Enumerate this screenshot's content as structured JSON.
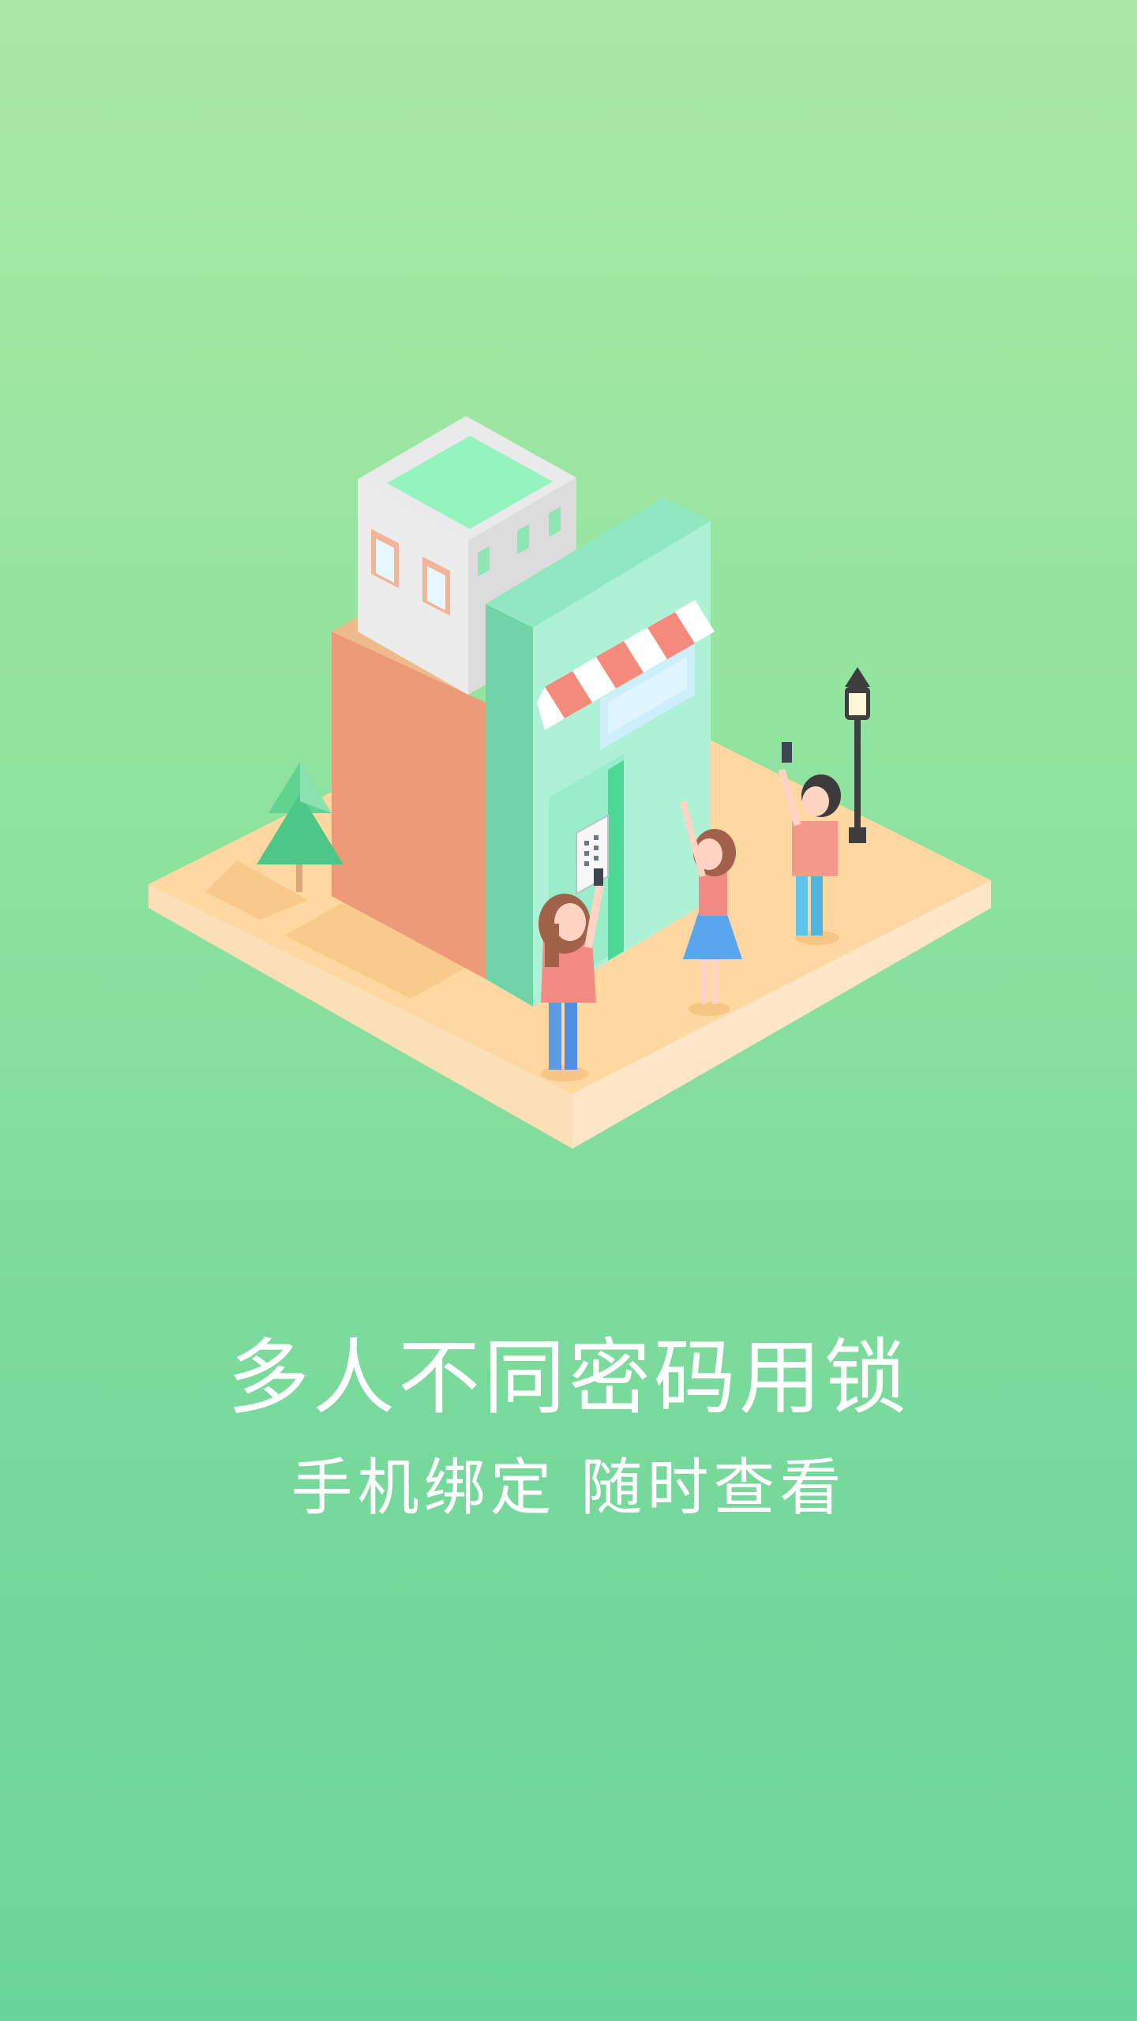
{
  "onboarding": {
    "headline": "多人不同密码用锁",
    "subline": "手机绑定  随时查看",
    "illustration": "isometric-building-with-people-using-smart-lock",
    "colors": {
      "background_top": "#aae8a6",
      "background_bottom": "#6ad59a",
      "text": "#ffffff"
    }
  }
}
